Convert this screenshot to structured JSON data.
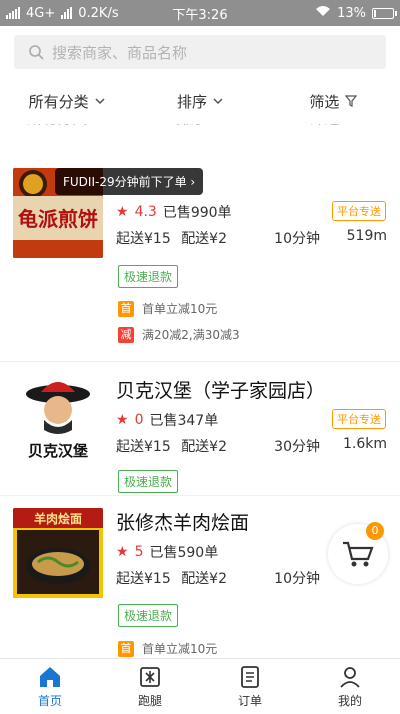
{
  "status_bar": {
    "network": "4G+",
    "speed": "0.2K/s",
    "time": "下午3:26",
    "battery": "13%",
    "battery_level": 0.13
  },
  "search": {
    "placeholder": "搜索商家、商品名称"
  },
  "filters": {
    "category": "所有分类",
    "sort": "排序",
    "filter": "筛选"
  },
  "toast": "FUDII-29分钟前下了单 ›",
  "shops": [
    {
      "name": "",
      "rating": "4.3",
      "sold": "已售990单",
      "badge": "平台专送",
      "min_order": "起送¥15",
      "delivery_fee": "配送¥2",
      "time": "10分钟",
      "distance": "519m",
      "refund": "极速退款",
      "promos": [
        {
          "tag": "首",
          "text": "首单立减10元",
          "color": "#ff9800"
        },
        {
          "tag": "减",
          "text": "满20减2,满30减3",
          "color": "#f44336"
        }
      ],
      "logo_text": "龟派煎饼"
    },
    {
      "name": "贝克汉堡（学子家园店）",
      "rating": "0",
      "sold": "已售347单",
      "badge": "平台专送",
      "min_order": "起送¥15",
      "delivery_fee": "配送¥2",
      "time": "30分钟",
      "distance": "1.6km",
      "refund": "极速退款",
      "logo_text": "贝克汉堡"
    },
    {
      "name": "张修杰羊肉烩面",
      "rating": "5",
      "sold": "已售590单",
      "min_order": "起送¥15",
      "delivery_fee": "配送¥2",
      "time": "10分钟",
      "distance": "",
      "refund": "极速退款",
      "promos": [
        {
          "tag": "首",
          "text": "首单立减10元",
          "color": "#ff9800"
        }
      ],
      "logo_text": "羊肉烩面"
    }
  ],
  "cart": {
    "count": "0"
  },
  "tabs": [
    {
      "label": "首页",
      "icon": "home-icon",
      "active": true
    },
    {
      "label": "跑腿",
      "icon": "errand-icon",
      "active": false
    },
    {
      "label": "订单",
      "icon": "order-icon",
      "active": false
    },
    {
      "label": "我的",
      "icon": "profile-icon",
      "active": false
    }
  ],
  "colors": {
    "accent": "#1976d2",
    "rating": "#e53935",
    "badge": "#ff9800",
    "refund": "#4caf50"
  }
}
